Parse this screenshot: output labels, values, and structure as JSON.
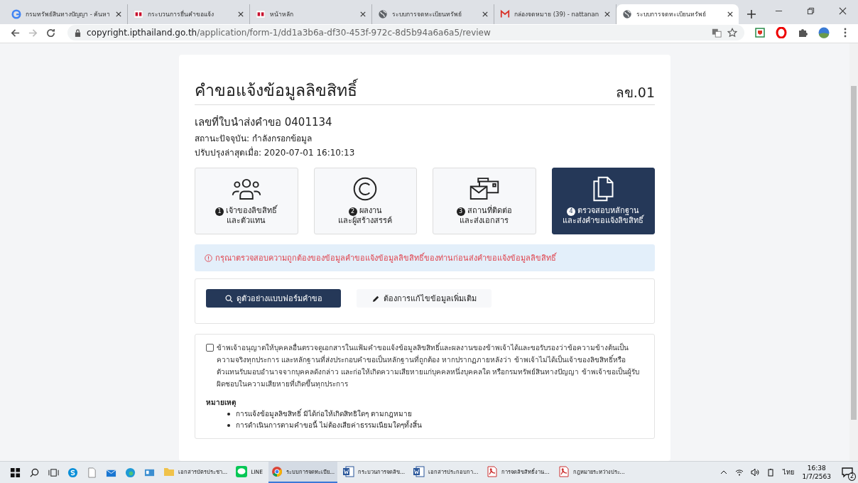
{
  "browser": {
    "tabs": [
      {
        "title": "กรมทรัพย์สินทางปัญญา - ค้นหา",
        "selected": false
      },
      {
        "title": "กระบวนการยื่นคำขอแจ้ง",
        "selected": false
      },
      {
        "title": "หน้าหลัก",
        "selected": false
      },
      {
        "title": "ระบบการจดทะเบียนทรัพย์",
        "selected": false
      },
      {
        "title": "กล่องจดหมาย (39) - nattanan",
        "selected": false
      },
      {
        "title": "ระบบการจดทะเบียนทรัพย์",
        "selected": true
      }
    ],
    "address": {
      "host": "copyright.ipthailand.go.th",
      "path": "/application/form-1/dd1a3b6a-df30-453f-972c-8d5b94a6a6a5/review"
    }
  },
  "page": {
    "title": "คำขอแจ้งข้อมูลลิขสิทธิ์",
    "form_code": "ลข.01",
    "number_label": "เลขที่ใบนำส่งคำขอ 0401134",
    "status": "สถานะปัจจุบัน: กำลังกรอกข้อมูล",
    "updated": "ปรับปรุงล่าสุดเมื่อ: 2020-07-01 16:10:13",
    "steps": [
      {
        "number": "1",
        "line1": "เจ้าของลิขสิทธิ์",
        "line2": "และตัวแทน",
        "selected": false
      },
      {
        "number": "2",
        "line1": "ผลงาน",
        "line2": "และผู้สร้างสรรค์",
        "selected": false
      },
      {
        "number": "3",
        "line1": "สถานที่ติดต่อ",
        "line2": "และส่งเอกสาร",
        "selected": false
      },
      {
        "number": "4",
        "line1": "ตรวจสอบหลักฐาน",
        "line2": "และส่งคำขอแจ้งลิขสิทธิ์",
        "selected": true
      }
    ],
    "alert": "กรุณาตรวจสอบความถูกต้องของข้อมูลคำขอแจ้งข้อมูลลิขสิทธิ์ของท่านก่อนส่งคำขอแจ้งข้อมูลลิขสิทธิ์",
    "buttons": [
      {
        "label": "ดูตัวอย่างแบบฟอร์มคำขอ",
        "kind": "primary"
      },
      {
        "label": "ต้องการแก้ไขข้อมูลเพิ่มเติม",
        "kind": "secondary"
      }
    ],
    "consent": {
      "checked": false,
      "text": "ข้าพเจ้าอนุญาตให้บุคคลอื่นตรวจดูเอกสารในแฟ้มคำขอแจ้งข้อมูลลิขสิทธิ์และผลงานของข้าพเจ้าได้และขอรับรองว่าข้อความข้างต้นเป็นความจริงทุกประการ และหลักฐานที่ส่งประกอบคำขอเป็นหลักฐานที่ถูกต้อง หากปรากฏภายหลังว่า ข้าพเจ้าไม่ได้เป็นเจ้าของลิขสิทธิ์หรือตัวแทนรับมอบอำนาจจากบุคคลดังกล่าว และก่อให้เกิดความเสียหายแก่บุคคลหนึ่งบุคคลใด หรือกรมทรัพย์สินทางปัญญา ข้าพเจ้าขอเป็นผู้รับผิดชอบในความเสียหายที่เกิดขึ้นทุกประการ"
    },
    "notes": {
      "heading": "หมายเหตุ",
      "items": [
        "การแจ้งข้อมูลลิขสิทธิ์ มิได้ก่อให้เกิดสิทธิใดๆ ตามกฎหมาย",
        "การดำเนินการตามคำขอนี้ ไม่ต้องเสียค่าธรรมเนียมใดๆทั้งสิ้น"
      ]
    }
  },
  "taskbar": {
    "items": [
      {
        "label": "เอกสารบัตรประชา...",
        "active": false
      },
      {
        "label": "LINE",
        "active": false
      },
      {
        "label": "ระบบการจดทะเบีย...",
        "active": true
      },
      {
        "label": "กระบวนการจดลิข...",
        "active": false
      },
      {
        "label": "เอกสารประกอบกา...",
        "active": false
      },
      {
        "label": "การจดลิขสิทธิ์งาน...",
        "active": false
      },
      {
        "label": "กฎหมายระหว่างประ...",
        "active": false
      }
    ],
    "language": "ไทย",
    "time": "16:38",
    "date": "1/7/2563",
    "notifications": "2"
  }
}
